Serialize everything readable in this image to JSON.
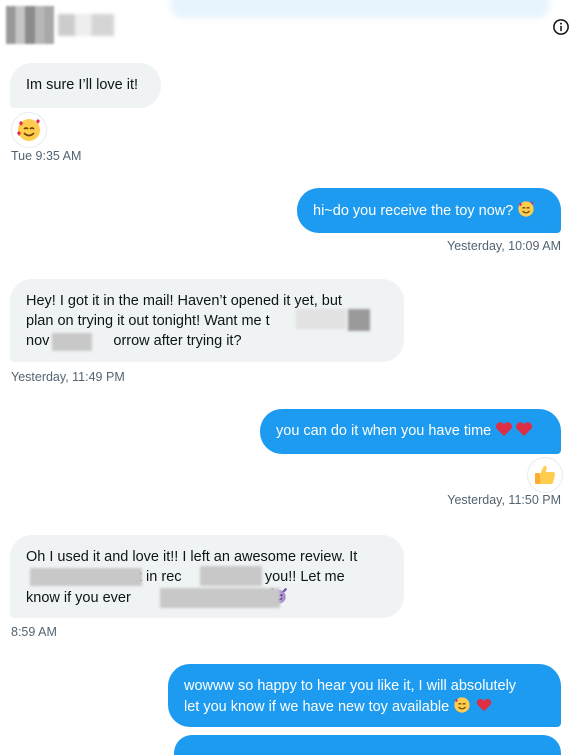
{
  "header": {
    "info_icon": "info-icon"
  },
  "messages": [
    {
      "direction": "in",
      "text": "Im sure I’ll love it!"
    },
    {
      "direction": "meta",
      "time": "Tue 9:35 AM",
      "reaction": "smiling-face-with-hearts"
    },
    {
      "direction": "out",
      "text": "hi~do you receive the toy now?",
      "emoji": "smiling-face-with-hearts",
      "time": "Yesterday, 10:09 AM"
    },
    {
      "direction": "in",
      "lines": [
        "Hey! I got it in the mail! Haven’t opened it yet, but",
        "plan on trying it out tonight! Want me t",
        "nov",
        "orrow after trying it?"
      ],
      "time": "Yesterday, 11:49 PM"
    },
    {
      "direction": "out",
      "text": "you can do it when you have time",
      "emoji": "red-hearts",
      "reaction": "thumbs-up",
      "time": "Yesterday, 11:50 PM"
    },
    {
      "direction": "in",
      "lines": [
        "Oh I used it and love it!! I left an awesome review. It",
        "t in rec",
        "nk you!! Let me",
        "know if you ever",
        "i"
      ],
      "emoji": "smiling-face-with-horns",
      "time": "8:59 AM"
    },
    {
      "direction": "out",
      "lines": [
        "wowww so happy to hear you like it, I will absolutely",
        "let you know if we have new toy available"
      ],
      "emoji": "smiling-face-with-hearts-and-red-heart"
    }
  ],
  "strings": {
    "m1": "Im sure I’ll love it!",
    "t1": "Tue 9:35 AM",
    "m2": "hi~do you receive the toy now?",
    "t2": "Yesterday, 10:09 AM",
    "m3a": "Hey! I got it in the mail! Haven’t opened it yet, but",
    "m3b": "plan on trying it out tonight! Want me t",
    "m3c1": "nov",
    "m3c2": "orrow after trying it?",
    "t3": "Yesterday, 11:49 PM",
    "m4": "you can do it when you have time",
    "t4": "Yesterday, 11:50 PM",
    "m5a": "Oh I used it and love it!! I left an awesome review. It",
    "m5b1": "t in rec",
    "m5b2": "nk you!! Let me",
    "m5c1": "know if you ever",
    "m5c2": "i",
    "t5": "8:59 AM",
    "m6a": "wowww so happy to hear you like it, I will absolutely",
    "m6b": "let you know if we have new toy available"
  },
  "colors": {
    "outgoing": "#1d9bf0",
    "incoming": "#eff3f4",
    "timestamp": "#536471"
  }
}
